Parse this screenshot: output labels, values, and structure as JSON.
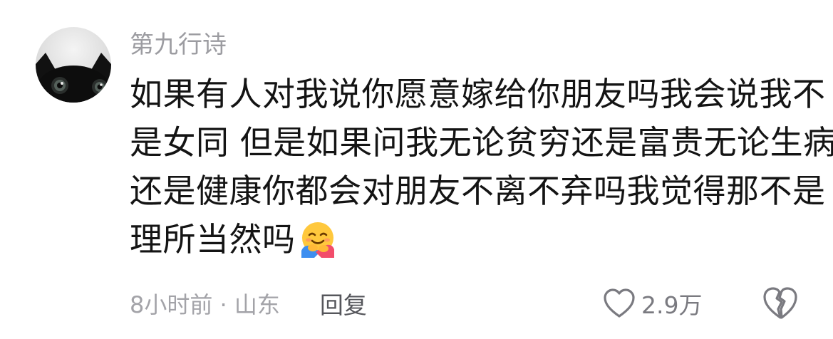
{
  "comment": {
    "username": "第九行诗",
    "text_lines": [
      "如果有人对我说你愿意嫁给你朋友吗我会说我不",
      "是女同 但是如果问我无论贫穷还是富贵无论生病",
      "还是健康你都会对朋友不离不弃吗我觉得那不是",
      "理所当然吗"
    ],
    "emoji": "hugging-face-emoji",
    "meta": {
      "time_location": "8小时前 · 山东",
      "reply_label": "回复"
    },
    "likes": {
      "count": "2.9万",
      "icon": "heart-outline-icon"
    },
    "dislike_icon": "broken-heart-icon",
    "colors": {
      "username": "#9c9ca1",
      "text": "#141414",
      "meta": "#a3a3a8",
      "reply": "#55565b",
      "icon": "#7a7a80"
    }
  }
}
